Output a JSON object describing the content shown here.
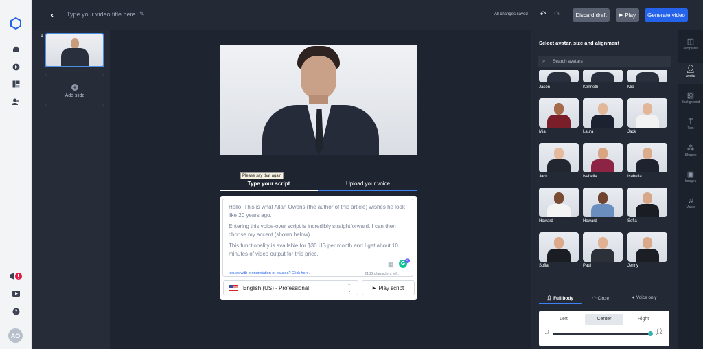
{
  "header": {
    "title_placeholder": "Type your video title here",
    "status": "All changes saved",
    "discard": "Discard draft",
    "play": "Play",
    "generate": "Generate video"
  },
  "slides": {
    "number": "1",
    "add": "Add slide"
  },
  "stage": {
    "tooltip": "Please say that again",
    "tab_script": "Type your script",
    "tab_voice": "Upload your voice",
    "script_p1": "Hello! This is what Allan Owens (the author of this article) wishes he look like 20 years ago.",
    "script_p2": "Entering this voice-over script is incredibly straightforward. I can then choose my accent (shown below).",
    "script_p3": "This functionality is available for $30 US per month and I get about 10 minutes of video output for this price.",
    "issues_link": "Issues with pronunciation or pauses? Click here.",
    "chars_left": "2183 characters left.",
    "grammarly_count": "2",
    "language": "English (US) - Professional",
    "play_script": "Play script"
  },
  "panel": {
    "heading": "Select avatar, size and alignment",
    "search_placeholder": "Search avatars",
    "top_row": [
      "Jason",
      "Kenneth",
      "Mia"
    ],
    "avatars": [
      {
        "name": "Mia",
        "skin": "#a56b4a",
        "suit": "#7a1f2a"
      },
      {
        "name": "Laura",
        "skin": "#e2b89a",
        "suit": "#1d2230"
      },
      {
        "name": "Jack",
        "skin": "#e3b69a",
        "suit": "#f2f2f2"
      },
      {
        "name": "Jack",
        "skin": "#e4b99c",
        "suit": "#222630"
      },
      {
        "name": "Isabella",
        "skin": "#d9a582",
        "suit": "#8e2443"
      },
      {
        "name": "Isabella",
        "skin": "#dcab8c",
        "suit": "#1f2330"
      },
      {
        "name": "Howard",
        "skin": "#7a4b33",
        "suit": "#f4f4f4"
      },
      {
        "name": "Howard",
        "skin": "#6f432d",
        "suit": "#6a8fbf"
      },
      {
        "name": "Sofia",
        "skin": "#d8a688",
        "suit": "#1b1d24"
      },
      {
        "name": "Sofia",
        "skin": "#dcaa8a",
        "suit": "#1b1d24"
      },
      {
        "name": "Paul",
        "skin": "#e0b293",
        "suit": "#2c3038"
      },
      {
        "name": "Jenny",
        "skin": "#d9a98a",
        "suit": "#1c1e26"
      }
    ],
    "size_tabs": [
      "Full body",
      "Circle",
      "Voice only"
    ],
    "align": [
      "Left",
      "Center",
      "Right"
    ]
  },
  "tools": [
    "Templates",
    "Avatar",
    "Background",
    "Text",
    "Shapes",
    "Images",
    "Music"
  ],
  "user": {
    "initials": "AO"
  },
  "colors": {
    "accent": "#2563eb",
    "slider": "#38b2ac"
  }
}
